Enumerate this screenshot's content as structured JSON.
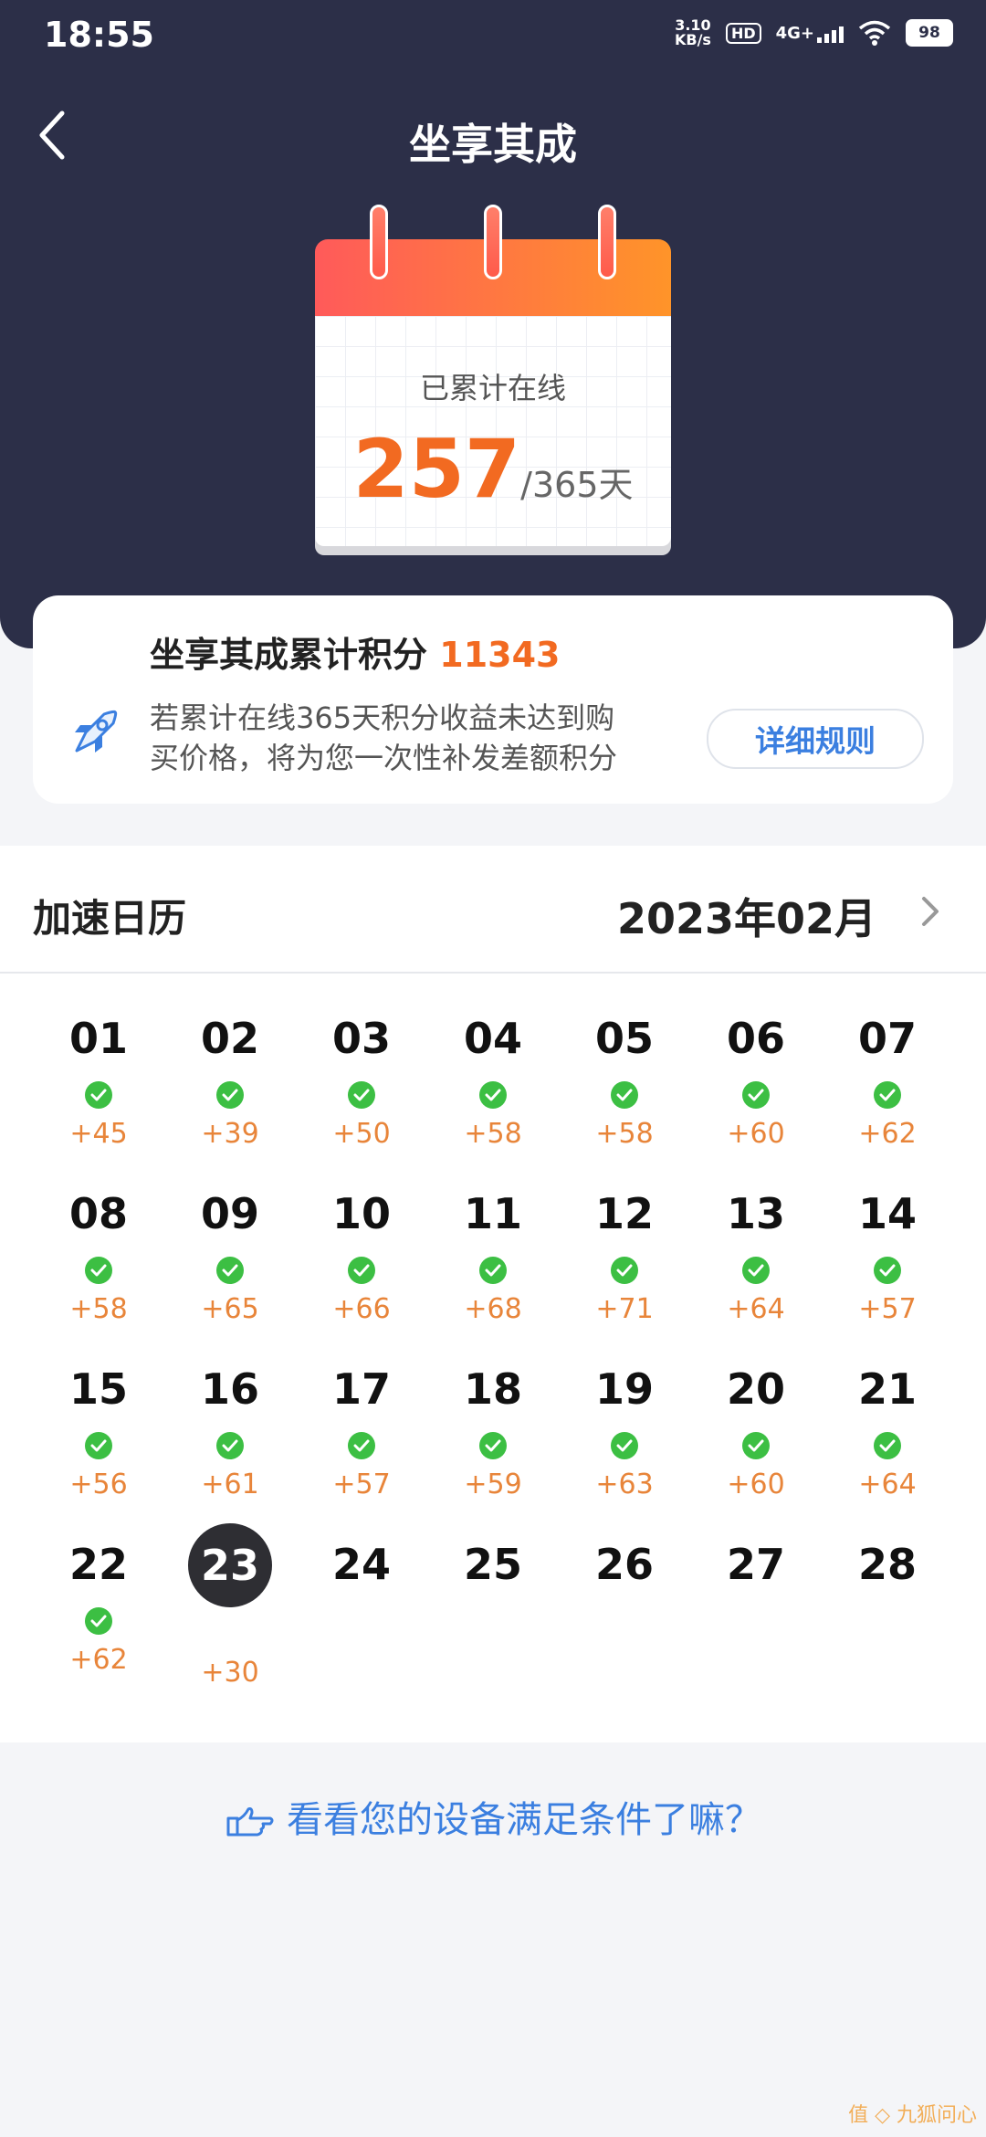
{
  "status": {
    "time": "18:55",
    "net_speed": "3.10",
    "net_unit": "KB/s",
    "hd": "HD",
    "signal": "4G+",
    "battery": "98"
  },
  "header": {
    "title": "坐享其成"
  },
  "calendar_widget": {
    "label": "已累计在线",
    "count": "257",
    "total": "/365天"
  },
  "points_card": {
    "label": "坐享其成累计积分",
    "value": "11343",
    "desc_line1": "若累计在线365天积分收益未达到购",
    "desc_line2": "买价格，将为您一次性补发差额积分",
    "rules_button": "详细规则"
  },
  "accel": {
    "title": "加速日历",
    "month": "2023年02月"
  },
  "days": [
    {
      "d": "01",
      "p": "+45",
      "done": true
    },
    {
      "d": "02",
      "p": "+39",
      "done": true
    },
    {
      "d": "03",
      "p": "+50",
      "done": true
    },
    {
      "d": "04",
      "p": "+58",
      "done": true
    },
    {
      "d": "05",
      "p": "+58",
      "done": true
    },
    {
      "d": "06",
      "p": "+60",
      "done": true
    },
    {
      "d": "07",
      "p": "+62",
      "done": true
    },
    {
      "d": "08",
      "p": "+58",
      "done": true
    },
    {
      "d": "09",
      "p": "+65",
      "done": true
    },
    {
      "d": "10",
      "p": "+66",
      "done": true
    },
    {
      "d": "11",
      "p": "+68",
      "done": true
    },
    {
      "d": "12",
      "p": "+71",
      "done": true
    },
    {
      "d": "13",
      "p": "+64",
      "done": true
    },
    {
      "d": "14",
      "p": "+57",
      "done": true
    },
    {
      "d": "15",
      "p": "+56",
      "done": true
    },
    {
      "d": "16",
      "p": "+61",
      "done": true
    },
    {
      "d": "17",
      "p": "+57",
      "done": true
    },
    {
      "d": "18",
      "p": "+59",
      "done": true
    },
    {
      "d": "19",
      "p": "+63",
      "done": true
    },
    {
      "d": "20",
      "p": "+60",
      "done": true
    },
    {
      "d": "21",
      "p": "+64",
      "done": true
    },
    {
      "d": "22",
      "p": "+62",
      "done": true
    },
    {
      "d": "23",
      "p": "+30",
      "done": false,
      "today": true
    },
    {
      "d": "24",
      "p": "",
      "done": false
    },
    {
      "d": "25",
      "p": "",
      "done": false
    },
    {
      "d": "26",
      "p": "",
      "done": false
    },
    {
      "d": "27",
      "p": "",
      "done": false
    },
    {
      "d": "28",
      "p": "",
      "done": false
    }
  ],
  "bottom_link": "看看您的设备满足条件了嘛？",
  "watermark": "九狐问心",
  "colors": {
    "header_bg": "#2c2f48",
    "accent_orange": "#f26a21",
    "link_blue": "#3b7fe0",
    "check_green": "#3cbf43"
  }
}
